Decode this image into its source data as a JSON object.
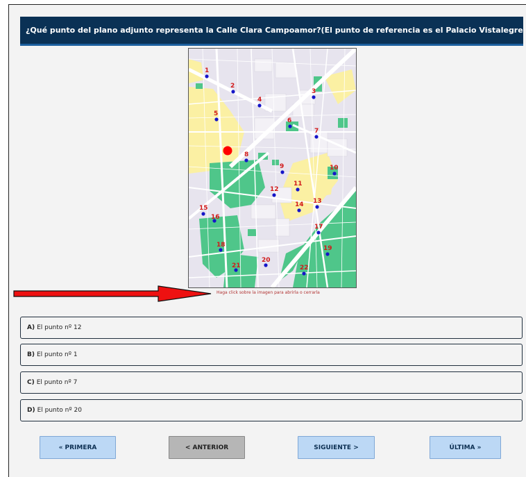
{
  "question": {
    "text": "¿Qué punto del plano adjunto representa la Calle Clara Campoamor?(El punto de referencia es el Palacio Vistalegre)"
  },
  "map": {
    "hint": "Haga click sobre la imagen para abrirla o cerrarla",
    "point_labels": [
      "1",
      "2",
      "3",
      "4",
      "5",
      "6",
      "7",
      "8",
      "9",
      "10",
      "11",
      "12",
      "13",
      "14",
      "15",
      "16",
      "17",
      "18",
      "19",
      "20",
      "21",
      "22"
    ],
    "reference_marker": "red-dot",
    "colors": {
      "point": "#1515c8",
      "label": "#d11919",
      "reference": "#ff0000",
      "park": "#4fc68a",
      "block": "#fbf0a3"
    }
  },
  "options": [
    {
      "letter": "A)",
      "text": "El punto nº 12"
    },
    {
      "letter": "B)",
      "text": "El punto nº 1"
    },
    {
      "letter": "C)",
      "text": "El punto nº 7"
    },
    {
      "letter": "D)",
      "text": "El punto nº 20"
    }
  ],
  "nav": {
    "first": "« PRIMERA",
    "previous": "< ANTERIOR",
    "next": "SIGUIENTE >",
    "last": "ÚLTIMA »"
  }
}
